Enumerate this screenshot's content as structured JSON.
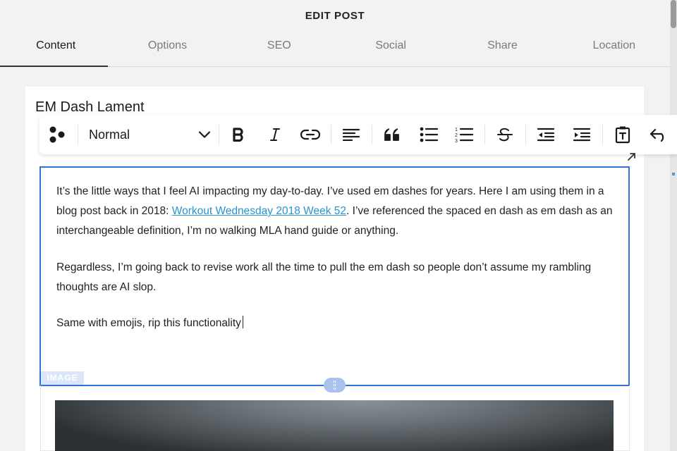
{
  "header": {
    "title": "EDIT POST",
    "tabs": [
      {
        "label": "Content",
        "active": true
      },
      {
        "label": "Options",
        "active": false
      },
      {
        "label": "SEO",
        "active": false
      },
      {
        "label": "Social",
        "active": false
      },
      {
        "label": "Share",
        "active": false
      },
      {
        "label": "Location",
        "active": false
      }
    ]
  },
  "post": {
    "title": "EM Dash Lament"
  },
  "toolbar": {
    "block_style": "Normal",
    "icons": [
      "blocks-icon",
      "chevron-down-icon",
      "bold-icon",
      "italic-icon",
      "link-icon",
      "align-left-icon",
      "quote-icon",
      "bullet-list-icon",
      "numbered-list-icon",
      "strikethrough-icon",
      "outdent-icon",
      "indent-icon",
      "paste-text-icon",
      "undo-icon"
    ]
  },
  "body": {
    "p1_before": "It’s the little ways that I feel AI impacting my day-to-day. I’ve used em dashes for years. Here I am using them in a blog post back in 2018: ",
    "p1_link": "Workout Wednesday 2018 Week 52",
    "p1_after": ". I’ve referenced the spaced en dash as em dash as an interchangeable definition, I’m no walking MLA hand guide or anything.",
    "p2": "Regardless, I’m going back to revise work all the time to pull the em dash so people don’t assume my rambling thoughts are AI slop.",
    "p3": "Same with emojis, rip this functionality"
  },
  "image_block": {
    "label": "IMAGE"
  },
  "colors": {
    "accent": "#2f73d4",
    "link": "#2a93cf",
    "background": "#f2f2f2"
  }
}
